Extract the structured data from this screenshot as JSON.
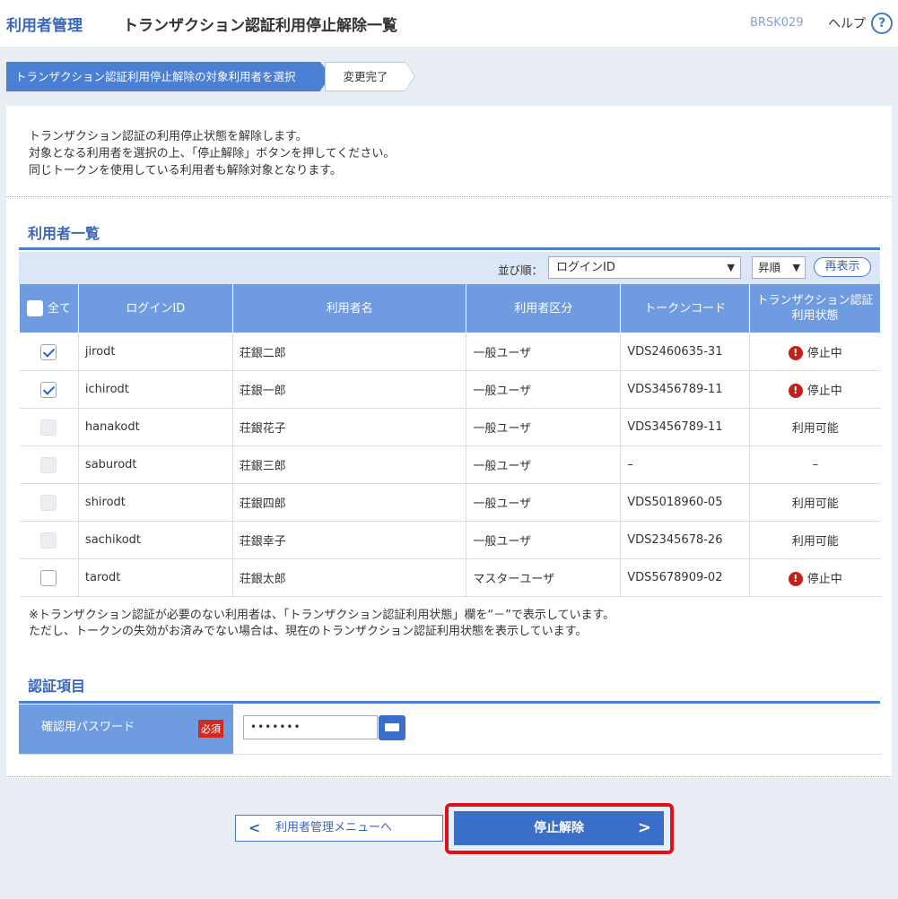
{
  "header": {
    "app_title": "利用者管理",
    "page_title": "トランザクション認証利用停止解除一覧",
    "screen_id": "BRSK029",
    "help_label": "ヘルプ",
    "help_icon": "?"
  },
  "steps": {
    "current": "トランザクション認証利用停止解除の対象利用者を選択",
    "next": "変更完了"
  },
  "intro": [
    "トランザクション認証の利用停止状態を解除します。",
    "対象となる利用者を選択の上、「停止解除」ボタンを押してください。",
    "同じトークンを使用している利用者も解除対象となります。"
  ],
  "user_list": {
    "title": "利用者一覧",
    "sort_label": "並び順：",
    "sort_value": "ログインID",
    "order_value": "昇順",
    "redisplay_label": "再表示",
    "columns": {
      "all": "全て",
      "login_id": "ログインID",
      "user_name": "利用者名",
      "user_type": "利用者区分",
      "token_code": "トークンコード",
      "status_line1": "トランザクション認証",
      "status_line2": "利用状態"
    },
    "rows": [
      {
        "login_id": "jirodt",
        "name": "荘銀二郎",
        "type": "一般ユーザ",
        "token": "VDS2460635-31",
        "status": "停止中",
        "checked": true,
        "enabled": true,
        "warn": true
      },
      {
        "login_id": "ichirodt",
        "name": "荘銀一郎",
        "type": "一般ユーザ",
        "token": "VDS3456789-11",
        "status": "停止中",
        "checked": true,
        "enabled": true,
        "warn": true
      },
      {
        "login_id": "hanakodt",
        "name": "荘銀花子",
        "type": "一般ユーザ",
        "token": "VDS3456789-11",
        "status": "利用可能",
        "checked": false,
        "enabled": false,
        "warn": false
      },
      {
        "login_id": "saburodt",
        "name": "荘銀三郎",
        "type": "一般ユーザ",
        "token": "–",
        "status": "–",
        "checked": false,
        "enabled": false,
        "warn": false
      },
      {
        "login_id": "shirodt",
        "name": "荘銀四郎",
        "type": "一般ユーザ",
        "token": "VDS5018960-05",
        "status": "利用可能",
        "checked": false,
        "enabled": false,
        "warn": false
      },
      {
        "login_id": "sachikodt",
        "name": "荘銀幸子",
        "type": "一般ユーザ",
        "token": "VDS2345678-26",
        "status": "利用可能",
        "checked": false,
        "enabled": false,
        "warn": false
      },
      {
        "login_id": "tarodt",
        "name": "荘銀太郎",
        "type": "マスターユーザ",
        "token": "VDS5678909-02",
        "status": "停止中",
        "checked": false,
        "enabled": true,
        "warn": true
      }
    ],
    "notes": [
      "※トランザクション認証が必要のない利用者は、「トランザクション認証利用状態」欄を“－”で表示しています。",
      "ただし、トークンの失効がお済みでない場合は、現在のトランザクション認証利用状態を表示しています。"
    ]
  },
  "auth": {
    "title": "認証項目",
    "password_label": "確認用パスワード",
    "required_badge": "必須",
    "password_value": "•••••••"
  },
  "buttons": {
    "back_label": "利用者管理メニューへ",
    "release_label": "停止解除"
  },
  "colors": {
    "accent": "#3a6ec9",
    "header_blue": "#6f9be0",
    "warning_red": "#c0211b",
    "highlight_red": "#e0101a"
  }
}
